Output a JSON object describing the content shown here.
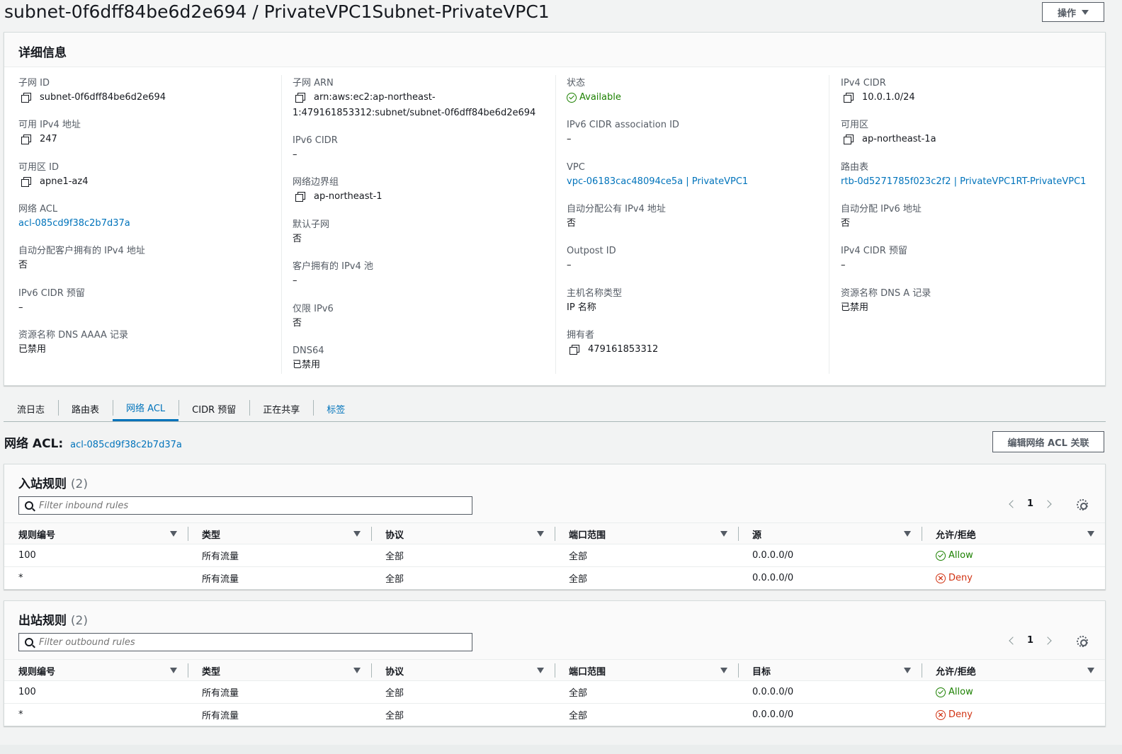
{
  "page": {
    "title": "subnet-0f6dff84be6d2e694 / PrivateVPC1Subnet-PrivateVPC1",
    "actions_label": "操作"
  },
  "details": {
    "title": "详细信息",
    "col1": [
      {
        "label": "子网 ID",
        "value": "subnet-0f6dff84be6d2e694"
      },
      {
        "label": "可用 IPv4 地址",
        "value": "247"
      },
      {
        "label": "可用区 ID",
        "value": "apne1-az4"
      },
      {
        "label": "网络 ACL",
        "value": "acl-085cd9f38c2b7d37a"
      },
      {
        "label": "自动分配客户拥有的 IPv4 地址",
        "value": "否"
      },
      {
        "label": "IPv6 CIDR 预留",
        "value": "–"
      },
      {
        "label": "资源名称 DNS AAAA 记录",
        "value": "已禁用"
      }
    ],
    "col2": [
      {
        "label": "子网 ARN",
        "value_line1": "arn:aws:ec2:ap-northeast-",
        "value_line2": "1:479161853312:subnet/subnet-0f6dff84be6d2e694"
      },
      {
        "label": "IPv6 CIDR",
        "value": "–"
      },
      {
        "label": "网络边界组",
        "value": "ap-northeast-1"
      },
      {
        "label": "默认子网",
        "value": "否"
      },
      {
        "label": "客户拥有的 IPv4 池",
        "value": "–"
      },
      {
        "label": "仅限 IPv6",
        "value": "否"
      },
      {
        "label": "DNS64",
        "value": "已禁用"
      }
    ],
    "col3": [
      {
        "label": "状态",
        "value": "Available"
      },
      {
        "label": "IPv6 CIDR association ID",
        "value": "–"
      },
      {
        "label": "VPC",
        "value": "vpc-06183cac48094ce5a | PrivateVPC1"
      },
      {
        "label": "自动分配公有 IPv4 地址",
        "value": "否"
      },
      {
        "label": "Outpost ID",
        "value": "–"
      },
      {
        "label": "主机名称类型",
        "value": "IP 名称"
      },
      {
        "label": "拥有者",
        "value": "479161853312"
      }
    ],
    "col4": [
      {
        "label": "IPv4 CIDR",
        "value": "10.0.1.0/24"
      },
      {
        "label": "可用区",
        "value": "ap-northeast-1a"
      },
      {
        "label": "路由表",
        "value": "rtb-0d5271785f023c2f2 | PrivateVPC1RT-PrivateVPC1"
      },
      {
        "label": "自动分配 IPv6 地址",
        "value": "否"
      },
      {
        "label": "IPv4 CIDR 预留",
        "value": "–"
      },
      {
        "label": "资源名称 DNS A 记录",
        "value": "已禁用"
      }
    ]
  },
  "tabs": [
    "流日志",
    "路由表",
    "网络 ACL",
    "CIDR 预留",
    "正在共享",
    "标签"
  ],
  "acl": {
    "heading": "网络 ACL:",
    "link": "acl-085cd9f38c2b7d37a",
    "edit_button": "编辑网络 ACL 关联"
  },
  "inbound": {
    "title": "入站规则",
    "count": "(2)",
    "filter_placeholder": "Filter inbound rules",
    "page": "1",
    "columns": [
      "规则编号",
      "类型",
      "协议",
      "端口范围",
      "源",
      "允许/拒绝"
    ],
    "rows": [
      [
        "100",
        "所有流量",
        "全部",
        "全部",
        "0.0.0.0/0",
        "Allow"
      ],
      [
        "*",
        "所有流量",
        "全部",
        "全部",
        "0.0.0.0/0",
        "Deny"
      ]
    ]
  },
  "outbound": {
    "title": "出站规则",
    "count": "(2)",
    "filter_placeholder": "Filter outbound rules",
    "page": "1",
    "columns": [
      "规则编号",
      "类型",
      "协议",
      "端口范围",
      "目标",
      "允许/拒绝"
    ],
    "rows": [
      [
        "100",
        "所有流量",
        "全部",
        "全部",
        "0.0.0.0/0",
        "Allow"
      ],
      [
        "*",
        "所有流量",
        "全部",
        "全部",
        "0.0.0.0/0",
        "Deny"
      ]
    ]
  },
  "colors": {
    "link": "#0073bb",
    "success": "#1d8102",
    "error": "#d13212"
  }
}
